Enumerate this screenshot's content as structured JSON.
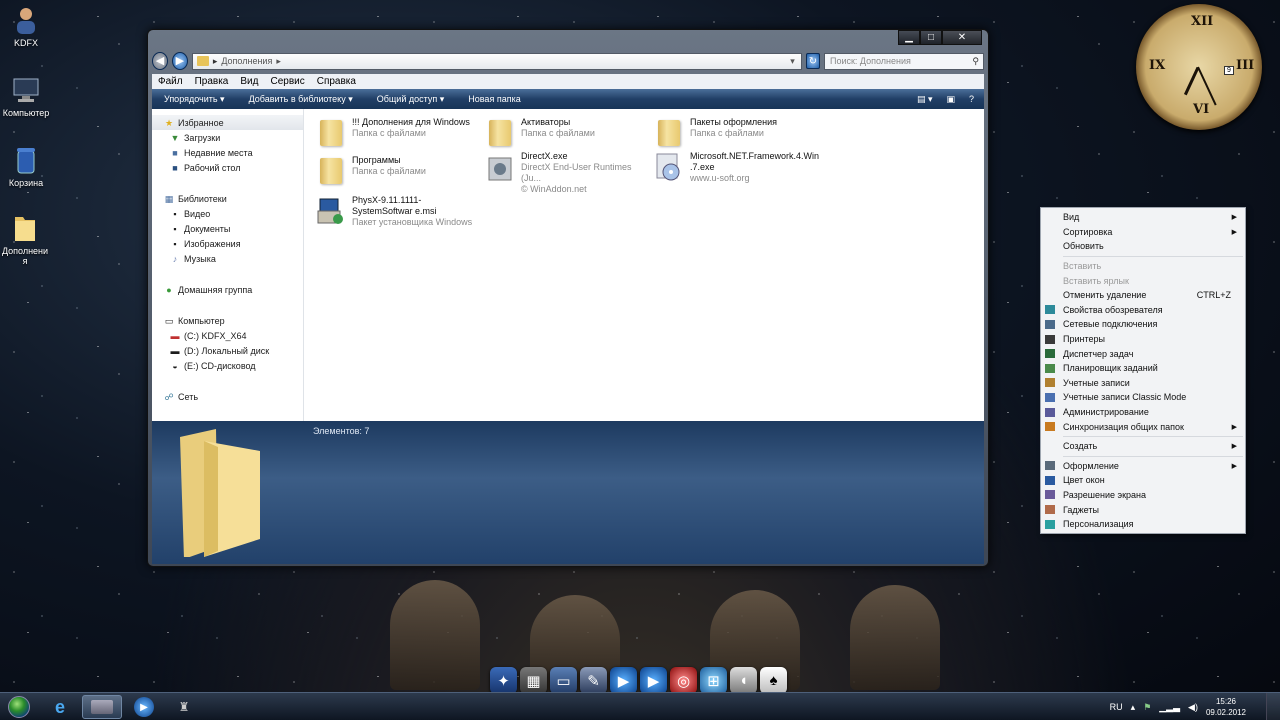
{
  "desktop": {
    "icons": [
      {
        "label": "KDFX",
        "icon": "user-icon"
      },
      {
        "label": "Компьютер",
        "icon": "computer-icon"
      },
      {
        "label": "Корзина",
        "icon": "recycle-bin-icon"
      },
      {
        "label": "Дополнени я",
        "icon": "folder-icon"
      }
    ]
  },
  "clock": {
    "date_badge": "9"
  },
  "explorer": {
    "address_crumb": "Дополнения",
    "search_placeholder": "Поиск: Дополнения",
    "menu": [
      "Файл",
      "Правка",
      "Вид",
      "Сервис",
      "Справка"
    ],
    "toolbar": [
      "Упорядочить ▾",
      "Добавить в библиотеку ▾",
      "Общий доступ ▾",
      "Новая папка"
    ],
    "nav": {
      "favorites": "Избранное",
      "fav_items": [
        "Загрузки",
        "Недавние места",
        "Рабочий стол"
      ],
      "libraries": "Библиотеки",
      "lib_items": [
        "Видео",
        "Документы",
        "Изображения",
        "Музыка"
      ],
      "homegroup": "Домашняя группа",
      "computer": "Компьютер",
      "drives": [
        "(C:) KDFX_X64",
        "(D:) Локальный диск",
        "(E:) CD-дисковод"
      ],
      "network": "Сеть"
    },
    "files": [
      {
        "name": "!!! Дополнения для Windows",
        "sub": "Папка с файлами",
        "sub2": ""
      },
      {
        "name": "Активаторы",
        "sub": "Папка с файлами",
        "sub2": ""
      },
      {
        "name": "Пакеты оформления",
        "sub": "Папка с файлами",
        "sub2": ""
      },
      {
        "name": "Программы",
        "sub": "Папка с файлами",
        "sub2": ""
      },
      {
        "name": "DirectX.exe",
        "sub": "DirectX End-User Runtimes (Ju...",
        "sub2": "© WinAddon.net"
      },
      {
        "name": "Microsoft.NET.Framework.4.Win .7.exe",
        "sub": "www.u-soft.org",
        "sub2": ""
      },
      {
        "name": "PhysX-9.11.1111-SystemSoftwar e.msi",
        "sub": "Пакет установщика Windows",
        "sub2": ""
      }
    ],
    "item_count": "Элементов: 7"
  },
  "context_menu": {
    "items": [
      {
        "label": "Вид",
        "arrow": "▶",
        "disabled": false
      },
      {
        "label": "Сортировка",
        "arrow": "▶",
        "disabled": false
      },
      {
        "label": "Обновить",
        "disabled": false
      },
      {
        "sep": true
      },
      {
        "label": "Вставить",
        "disabled": true
      },
      {
        "label": "Вставить ярлык",
        "disabled": true
      },
      {
        "label": "Отменить удаление",
        "shortcut": "CTRL+Z",
        "disabled": false
      },
      {
        "label": "Свойства обозревателя",
        "disabled": false
      },
      {
        "label": "Сетевые подключения",
        "disabled": false
      },
      {
        "label": "Принтеры",
        "disabled": false
      },
      {
        "label": "Диспетчер задач",
        "disabled": false
      },
      {
        "label": "Планировщик заданий",
        "disabled": false
      },
      {
        "label": "Учетные записи",
        "disabled": false
      },
      {
        "label": "Учетные записи Classic Mode",
        "disabled": false
      },
      {
        "label": "Администрирование",
        "disabled": false
      },
      {
        "label": "Синхронизация общих папок",
        "arrow": "▶",
        "disabled": false
      },
      {
        "sep": true
      },
      {
        "label": "Создать",
        "arrow": "▶",
        "disabled": false
      },
      {
        "sep": true
      },
      {
        "label": "Оформление",
        "arrow": "▶",
        "disabled": false
      },
      {
        "label": "Цвет окон",
        "disabled": false
      },
      {
        "label": "Разрешение экрана",
        "disabled": false
      },
      {
        "label": "Гаджеты",
        "disabled": false
      },
      {
        "label": "Персонализация",
        "disabled": false
      }
    ]
  },
  "taskbar": {
    "lang": "RU",
    "time": "15:26",
    "date": "09.02.2012"
  }
}
